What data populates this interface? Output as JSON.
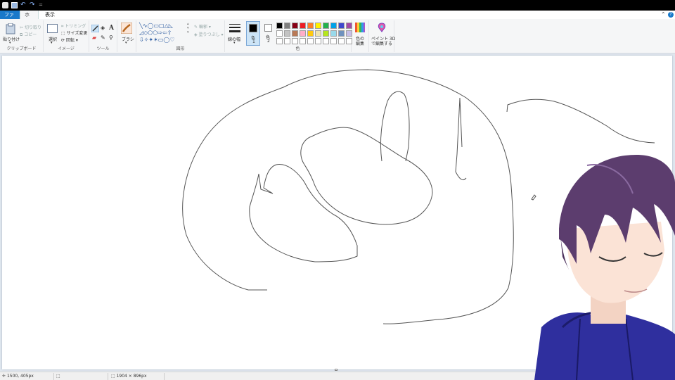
{
  "menu": {
    "file_tab": "ファイル",
    "home_tab": "ホーム",
    "view_tab": "表示",
    "help_icon": "?"
  },
  "ribbon": {
    "clipboard": {
      "paste": "貼り付け",
      "cut": "切り取り",
      "copy": "コピー",
      "label": "クリップボード"
    },
    "image": {
      "select": "選択",
      "crop": "トリミング",
      "resize": "サイズ変更",
      "rotate": "回転",
      "label": "イメージ"
    },
    "tools": {
      "label": "ツール",
      "text_tool": "A"
    },
    "brushes": {
      "label": "ブラシ"
    },
    "shapes": {
      "outline": "輪郭",
      "fill": "塗りつぶし",
      "label": "図形"
    },
    "size": {
      "label": "線の幅"
    },
    "colors": {
      "color1": "色",
      "color1_num": "1",
      "color2": "色",
      "color2_num": "2",
      "edit": "色の",
      "edit2": "編集",
      "label": "色",
      "palette_row1": [
        "#000000",
        "#7f7f7f",
        "#880015",
        "#ed1c24",
        "#ff7f27",
        "#fff200",
        "#22b14c",
        "#00a2e8",
        "#3f48cc",
        "#a349a4"
      ],
      "palette_row2": [
        "#ffffff",
        "#c3c3c3",
        "#b97a57",
        "#ffaec9",
        "#ffc90e",
        "#efe4b0",
        "#b5e61d",
        "#99d9ea",
        "#7092be",
        "#c8bfe7"
      ],
      "palette_row3": [
        "#ffffff",
        "#ffffff",
        "#ffffff",
        "#ffffff",
        "#ffffff",
        "#ffffff",
        "#ffffff",
        "#ffffff",
        "#ffffff",
        "#ffffff"
      ],
      "selected_color1": "#000000",
      "selected_color2": "#ffffff"
    },
    "paint3d": {
      "line1": "ペイント 3D",
      "line2": "で編集する"
    }
  },
  "status": {
    "cursor_pos": "1500, 405px",
    "canvas_size": "1904 × 896px"
  },
  "icons": {
    "paste": "clipboard-icon",
    "select": "select-rect-icon",
    "pencil": "pencil-icon",
    "brush": "brush-icon",
    "paint3d": "paint3d-icon"
  }
}
